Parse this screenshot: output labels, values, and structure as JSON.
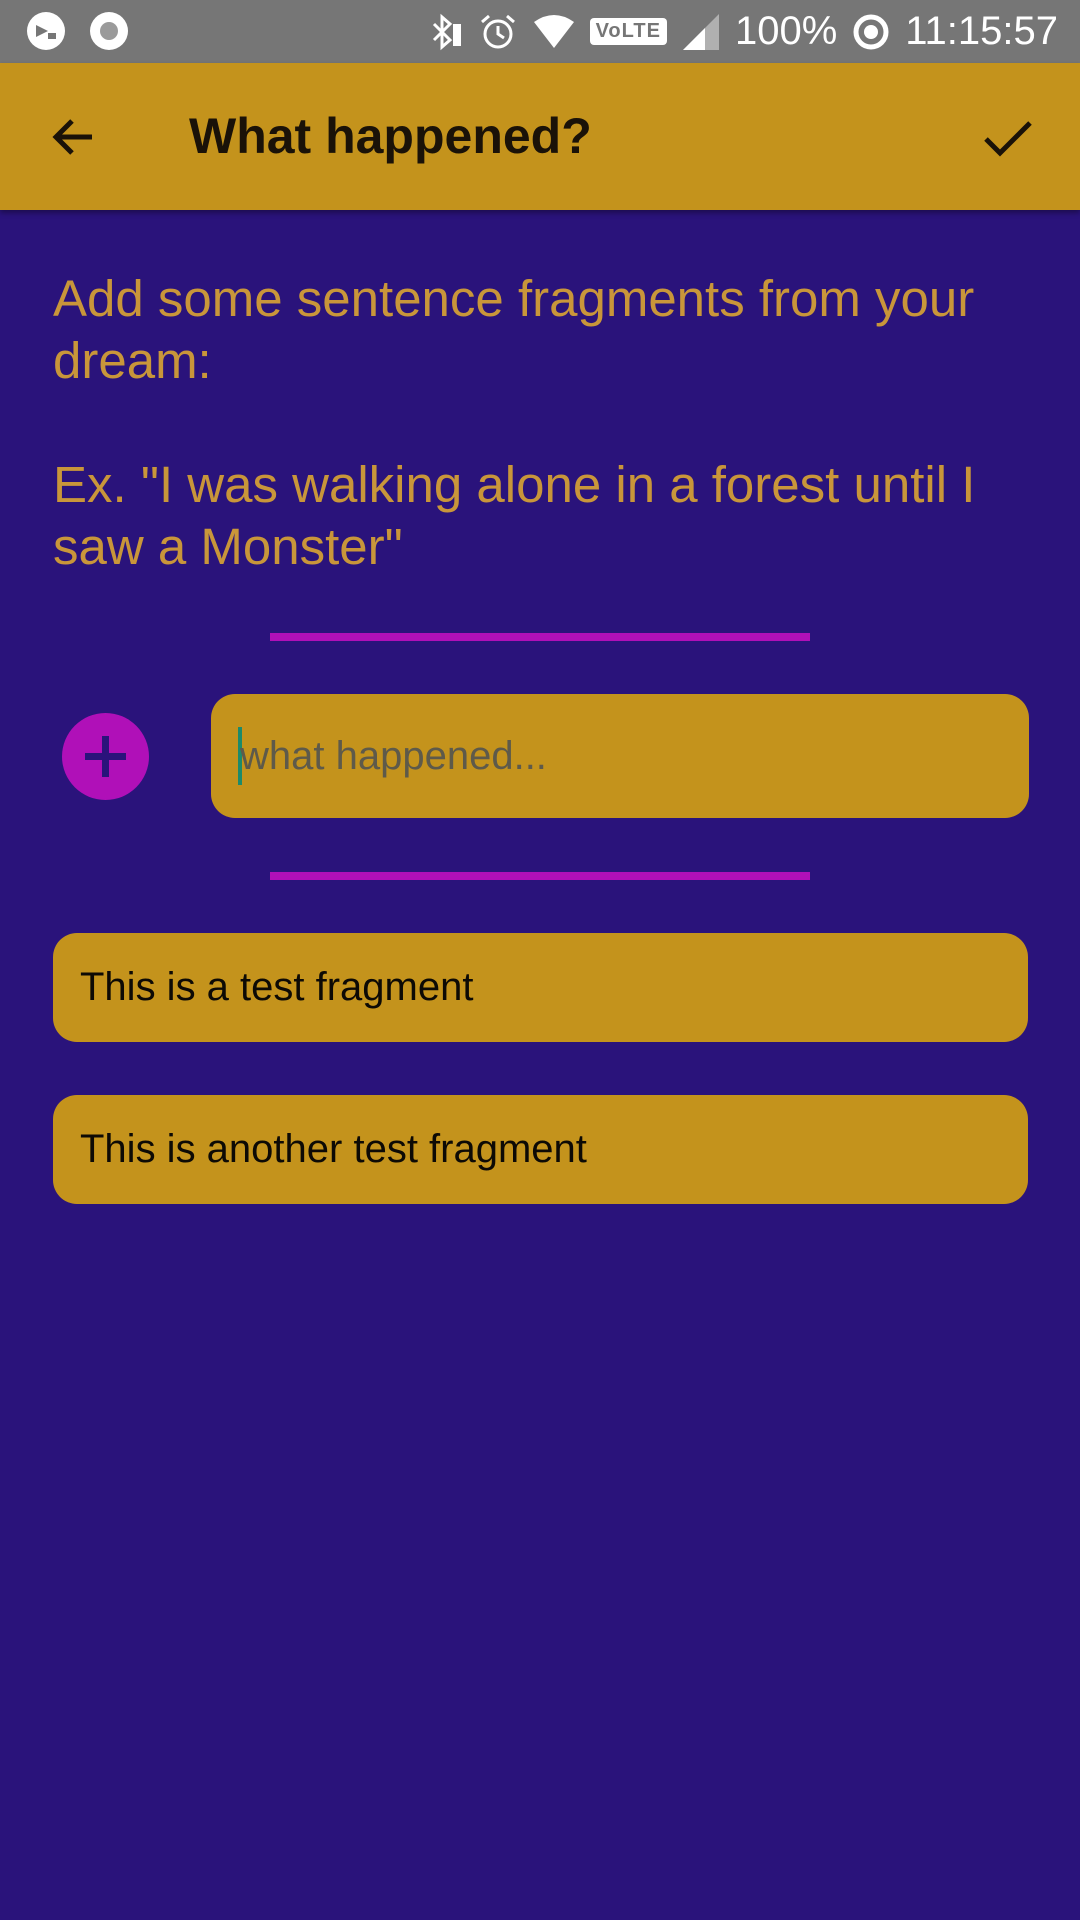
{
  "status_bar": {
    "battery": "100%",
    "time": "11:15:57",
    "network_badge": "VoLTE",
    "icons": [
      "app-notification-icon",
      "record-icon",
      "bluetooth-icon",
      "alarm-icon",
      "wifi-icon",
      "signal-icon",
      "sync-icon"
    ]
  },
  "app_bar": {
    "title": "What happened?",
    "back_icon": "arrow-back-icon",
    "done_icon": "check-icon"
  },
  "instructions": {
    "line1": "Add some sentence fragments from your dream:",
    "line2": "Ex. \"I was walking alone in a forest until I saw a Monster\""
  },
  "input": {
    "placeholder": "what happened...",
    "value": ""
  },
  "fragments": [
    "This is a test fragment",
    "This is another test fragment"
  ],
  "colors": {
    "background": "#2a137b",
    "accent": "#c4931c",
    "divider": "#b010b8",
    "instruction_text": "#c9963a",
    "status_bar": "#767676"
  }
}
